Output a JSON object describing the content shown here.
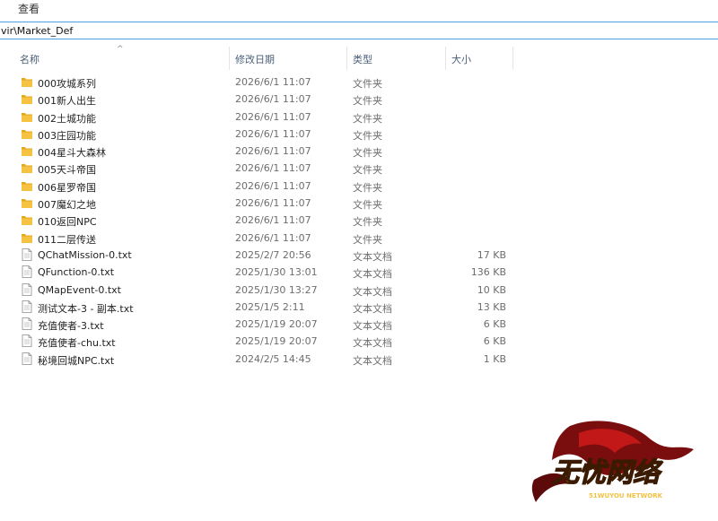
{
  "menubar": {
    "view_label": "查看"
  },
  "address": {
    "path": "vir\\Market_Def"
  },
  "columns": {
    "name": "名称",
    "modified": "修改日期",
    "type": "类型",
    "size": "大小"
  },
  "files": [
    {
      "name": "000攻城系列",
      "modified": "2026/6/1 11:07",
      "type": "文件夹",
      "size": "",
      "kind": "folder"
    },
    {
      "name": "001新人出生",
      "modified": "2026/6/1 11:07",
      "type": "文件夹",
      "size": "",
      "kind": "folder"
    },
    {
      "name": "002土城功能",
      "modified": "2026/6/1 11:07",
      "type": "文件夹",
      "size": "",
      "kind": "folder"
    },
    {
      "name": "003庄园功能",
      "modified": "2026/6/1 11:07",
      "type": "文件夹",
      "size": "",
      "kind": "folder"
    },
    {
      "name": "004星斗大森林",
      "modified": "2026/6/1 11:07",
      "type": "文件夹",
      "size": "",
      "kind": "folder"
    },
    {
      "name": "005天斗帝国",
      "modified": "2026/6/1 11:07",
      "type": "文件夹",
      "size": "",
      "kind": "folder"
    },
    {
      "name": "006星罗帝国",
      "modified": "2026/6/1 11:07",
      "type": "文件夹",
      "size": "",
      "kind": "folder"
    },
    {
      "name": "007魔幻之地",
      "modified": "2026/6/1 11:07",
      "type": "文件夹",
      "size": "",
      "kind": "folder"
    },
    {
      "name": "010返回NPC",
      "modified": "2026/6/1 11:07",
      "type": "文件夹",
      "size": "",
      "kind": "folder"
    },
    {
      "name": "011二层传送",
      "modified": "2026/6/1 11:07",
      "type": "文件夹",
      "size": "",
      "kind": "folder"
    },
    {
      "name": "QChatMission-0.txt",
      "modified": "2025/2/7 20:56",
      "type": "文本文档",
      "size": "17 KB",
      "kind": "file"
    },
    {
      "name": "QFunction-0.txt",
      "modified": "2025/1/30 13:01",
      "type": "文本文档",
      "size": "136 KB",
      "kind": "file"
    },
    {
      "name": "QMapEvent-0.txt",
      "modified": "2025/1/30 13:27",
      "type": "文本文档",
      "size": "10 KB",
      "kind": "file"
    },
    {
      "name": "测试文本-3 - 副本.txt",
      "modified": "2025/1/5 2:11",
      "type": "文本文档",
      "size": "13 KB",
      "kind": "file"
    },
    {
      "name": "充值使者-3.txt",
      "modified": "2025/1/19 20:07",
      "type": "文本文档",
      "size": "6 KB",
      "kind": "file"
    },
    {
      "name": "充值使者-chu.txt",
      "modified": "2025/1/19 20:07",
      "type": "文本文档",
      "size": "6 KB",
      "kind": "file"
    },
    {
      "name": "秘境回城NPC.txt",
      "modified": "2024/2/5 14:45",
      "type": "文本文档",
      "size": "1 KB",
      "kind": "file"
    }
  ],
  "watermark": {
    "main_text": "无忧网络",
    "sub_text": "51WUYOU NETWORK"
  },
  "colors": {
    "folder": "#f5c242",
    "folder_dark": "#e3a81c",
    "header_text": "#4c607a",
    "address_border": "#4aa0e0"
  }
}
